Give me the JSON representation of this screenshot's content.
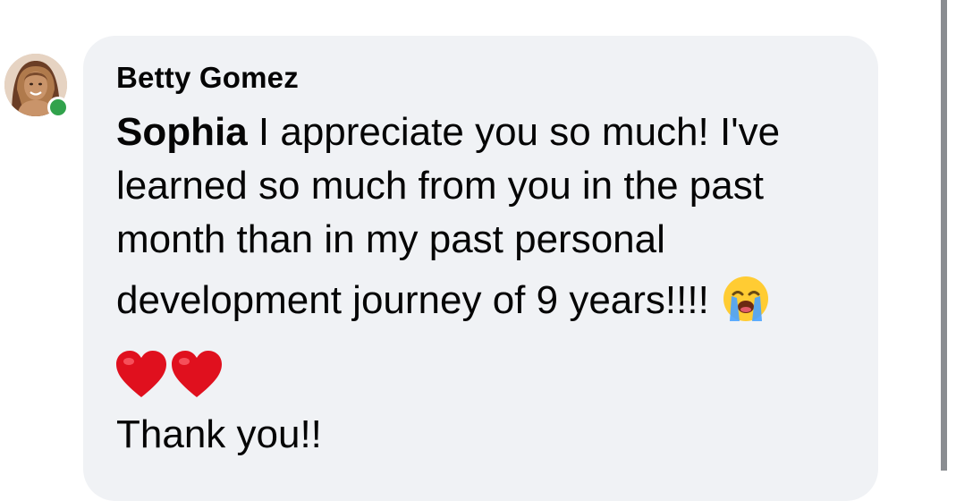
{
  "comment": {
    "author": "Betty Gomez",
    "mention": "Sophia",
    "line1_rest": " I appreciate you so much! I've",
    "line2": "learned so much from you in the past",
    "line3": "month than in my past personal",
    "line4": "development journey of 9 years!!!!",
    "closing": "Thank you!!",
    "emoji_after_line4": "loudly-crying-face-icon",
    "reaction_emojis": [
      "red-heart-icon",
      "red-heart-icon"
    ]
  },
  "colors": {
    "bubble": "#f0f2f5",
    "presence": "#31a24c",
    "text": "#050505",
    "heart": "#e0101e",
    "emoji_face": "#ffcc33",
    "tears": "#4aa3ff",
    "scrollbar": "#8a8d91"
  }
}
